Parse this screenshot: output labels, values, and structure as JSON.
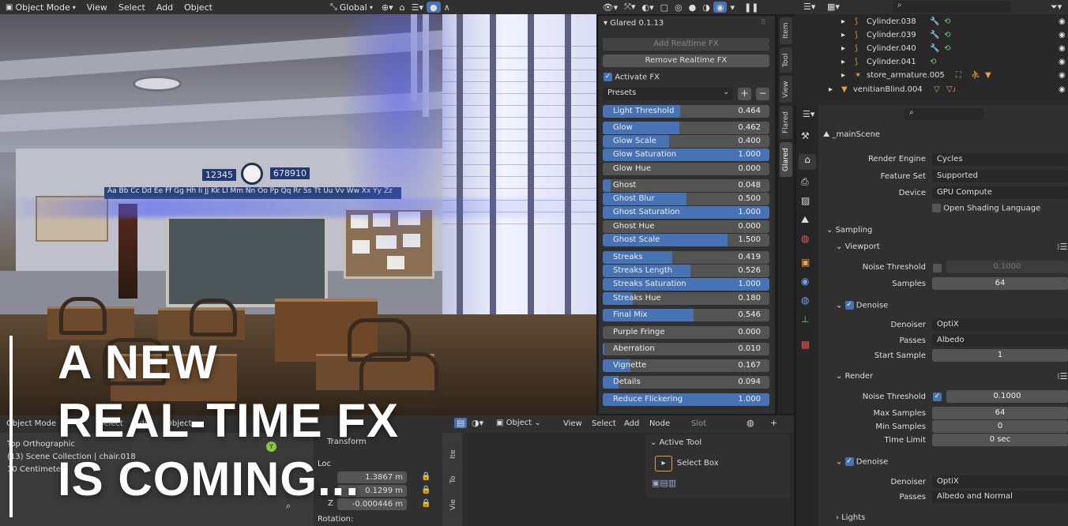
{
  "topbar": {
    "mode": "Object Mode",
    "menus": [
      "View",
      "Select",
      "Add",
      "Object"
    ],
    "orientation": "Global"
  },
  "overlay": {
    "headline_lines": [
      "A NEW",
      "REAL-TIME FX",
      "IS COMING..."
    ]
  },
  "scene_signs": {
    "left_numbers": "12345",
    "right_numbers": "678910",
    "alphabet": "Aa Bb Cc Dd Ee Ff Gg Hh Ii Jj Kk Ll Mm Nn Oo Pp Qq Rr Ss Tt Uu Vv Ww Xx Yy Zz"
  },
  "glared": {
    "title": "Glared 0.1.13",
    "add_fx": "Add Realtime FX",
    "remove_fx": "Remove Realtime FX",
    "activate_label": "Activate FX",
    "activate_checked": true,
    "presets_label": "Presets",
    "sliders": [
      {
        "label": "Light Threshold",
        "value": "0.464",
        "fill": 0.464
      },
      {
        "label": "Glow",
        "value": "0.462",
        "fill": 0.462
      },
      {
        "label": "Glow Scale",
        "value": "0.400",
        "fill": 0.4
      },
      {
        "label": "Glow Saturation",
        "value": "1.000",
        "fill": 1.0
      },
      {
        "label": "Glow Hue",
        "value": "0.000",
        "fill": 0.0
      },
      {
        "label": "Ghost",
        "value": "0.048",
        "fill": 0.048
      },
      {
        "label": "Ghost Blur",
        "value": "0.500",
        "fill": 0.5
      },
      {
        "label": "Ghost Saturation",
        "value": "1.000",
        "fill": 1.0
      },
      {
        "label": "Ghost Hue",
        "value": "0.000",
        "fill": 0.0
      },
      {
        "label": "Ghost Scale",
        "value": "1.500",
        "fill": 0.75
      },
      {
        "label": "Streaks",
        "value": "0.419",
        "fill": 0.419
      },
      {
        "label": "Streaks Length",
        "value": "0.526",
        "fill": 0.526
      },
      {
        "label": "Streaks Saturation",
        "value": "1.000",
        "fill": 1.0
      },
      {
        "label": "Streaks Hue",
        "value": "0.180",
        "fill": 0.18
      },
      {
        "label": "Final Mix",
        "value": "0.546",
        "fill": 0.546
      },
      {
        "label": "Purple Fringe",
        "value": "0.000",
        "fill": 0.0
      },
      {
        "label": "Aberration",
        "value": "0.010",
        "fill": 0.01
      },
      {
        "label": "Vignette",
        "value": "0.167",
        "fill": 0.167
      },
      {
        "label": "Details",
        "value": "0.094",
        "fill": 0.094
      },
      {
        "label": "Reduce Flickering",
        "value": "1.000",
        "fill": 1.0
      }
    ]
  },
  "sidebar_tabs": [
    "Item",
    "Tool",
    "View",
    "Flared",
    "Glared"
  ],
  "outliner": {
    "rows": [
      {
        "name": "Cylinder.038"
      },
      {
        "name": "Cylinder.039"
      },
      {
        "name": "Cylinder.040"
      },
      {
        "name": "Cylinder.041"
      },
      {
        "name": "store_armature.005"
      },
      {
        "name": "venitianBlind.004"
      }
    ]
  },
  "properties": {
    "scene_name": "_mainScene",
    "render_engine_label": "Render Engine",
    "render_engine": "Cycles",
    "feature_set_label": "Feature Set",
    "feature_set": "Supported",
    "device_label": "Device",
    "device": "GPU Compute",
    "osl_label": "Open Shading Language",
    "sampling": "Sampling",
    "viewport": "Viewport",
    "noise_threshold_label": "Noise Threshold",
    "viewport_noise": "0.1000",
    "samples_label": "Samples",
    "viewport_samples": "64",
    "denoise_label": "Denoise",
    "denoiser_label": "Denoiser",
    "viewport_denoiser": "OptiX",
    "passes_label": "Passes",
    "viewport_passes": "Albedo",
    "start_sample_label": "Start Sample",
    "start_sample": "1",
    "render": "Render",
    "render_noise": "0.1000",
    "max_samples_label": "Max Samples",
    "max_samples": "64",
    "min_samples_label": "Min Samples",
    "min_samples": "0",
    "time_limit_label": "Time Limit",
    "time_limit": "0 sec",
    "render_denoiser": "OptiX",
    "render_passes": "Albedo and Normal",
    "lights": "Lights"
  },
  "bottom": {
    "mode": "Object Mode",
    "menus": [
      "Select",
      "Add",
      "Object"
    ],
    "view_name": "Top Orthographic",
    "collection": "(13) Scene Collection | chair.018",
    "scale": "10 Centimeters",
    "transform": "Transform",
    "location": "Loc",
    "loc_x": "1.3867 m",
    "loc_y": "0.1299 m",
    "loc_z": "-0.000446 m",
    "z_label": "Z",
    "rotation": "Rotation:",
    "node_object": "Object",
    "node_menus": [
      "View",
      "Select",
      "Add",
      "Node"
    ],
    "slot": "Slot",
    "active_tool": "Active Tool",
    "select_box": "Select Box",
    "side_tabs": [
      "Ite",
      "To",
      "Vie"
    ]
  }
}
